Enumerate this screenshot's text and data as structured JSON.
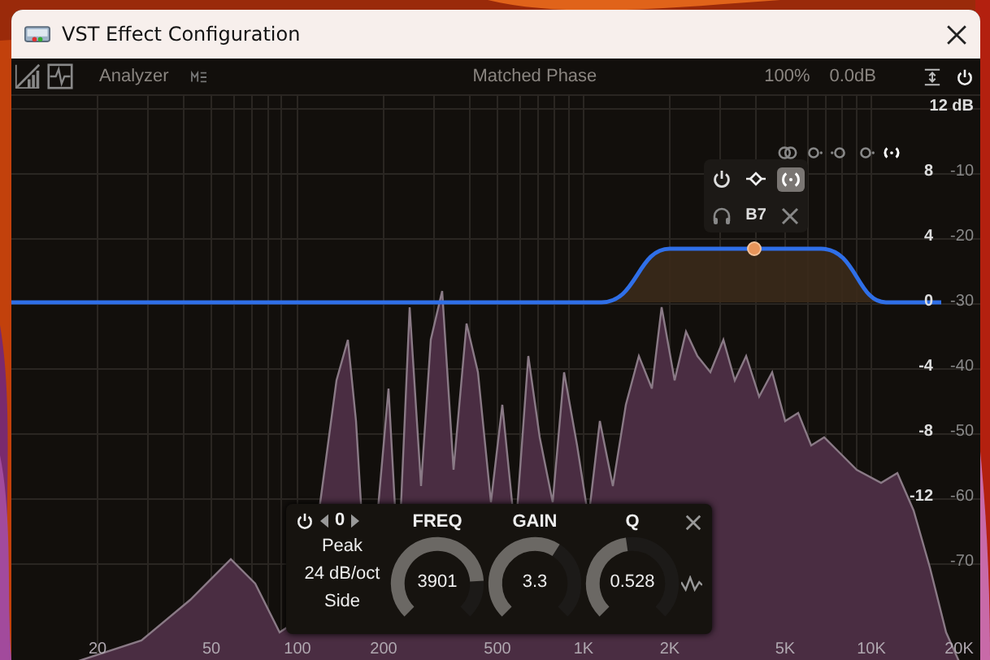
{
  "window": {
    "title": "VST Effect Configuration"
  },
  "toolbar": {
    "analyzer_label": "Analyzer",
    "phase_mode": "Matched Phase",
    "scale": "100%",
    "output_gain": "0.0dB"
  },
  "graph": {
    "level_rows": [
      {
        "gain": "12 dB"
      },
      {
        "gain": "8",
        "range": "-10"
      },
      {
        "gain": "4",
        "range": "-20"
      },
      {
        "gain": "0",
        "range": "-30"
      },
      {
        "gain": "-4",
        "range": "-40"
      },
      {
        "gain": "-8",
        "range": "-50"
      },
      {
        "gain": "-12",
        "range": "-60"
      },
      {
        "range": "-70"
      }
    ],
    "freq_labels": [
      "20",
      "50",
      "100",
      "200",
      "500",
      "1K",
      "2K",
      "5K",
      "10K",
      "20K"
    ]
  },
  "stereo_modes": [
    {
      "selected": false
    },
    {
      "selected": false
    },
    {
      "selected": false
    },
    {
      "selected": false
    },
    {
      "selected": true
    }
  ],
  "node_popup": {
    "band": "B7",
    "stereo_selected": true
  },
  "band_panel": {
    "band_index": "0",
    "filter_type": "Peak",
    "slope": "24 dB/oct",
    "channel": "Side",
    "knobs": [
      {
        "label": "FREQ",
        "value": "3901",
        "level": 0.82
      },
      {
        "label": "GAIN",
        "value": "3.3",
        "level": 0.62
      },
      {
        "label": "Q",
        "value": "0.528",
        "level": 0.47
      }
    ]
  }
}
